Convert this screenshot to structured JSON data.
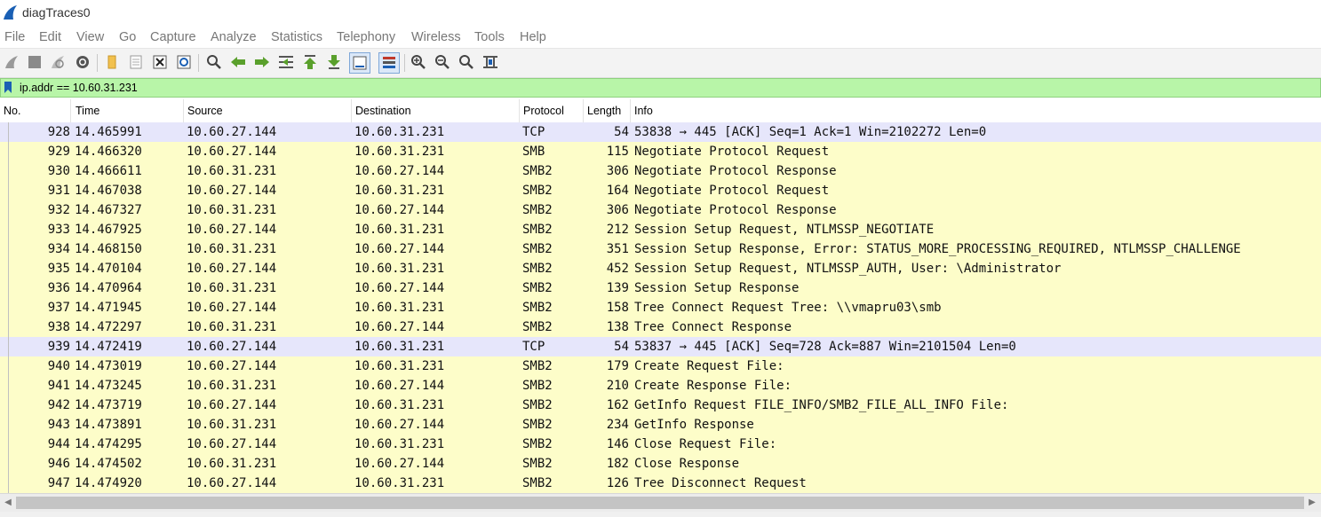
{
  "window": {
    "title": "diagTraces0"
  },
  "menu": [
    "File",
    "Edit",
    "View",
    "Go",
    "Capture",
    "Analyze",
    "Statistics",
    "Telephony",
    "Wireless",
    "Tools",
    "Help"
  ],
  "filter": {
    "value": "ip.addr == 10.60.31.231"
  },
  "columns": [
    "No.",
    "Time",
    "Source",
    "Destination",
    "Protocol",
    "Length",
    "Info"
  ],
  "packets": [
    {
      "no": "928",
      "time": "14.465991",
      "src": "10.60.27.144",
      "dst": "10.60.31.231",
      "proto": "TCP",
      "len": "54",
      "info": "53838 → 445 [ACK] Seq=1 Ack=1 Win=2102272 Len=0"
    },
    {
      "no": "929",
      "time": "14.466320",
      "src": "10.60.27.144",
      "dst": "10.60.31.231",
      "proto": "SMB",
      "len": "115",
      "info": "Negotiate Protocol Request"
    },
    {
      "no": "930",
      "time": "14.466611",
      "src": "10.60.31.231",
      "dst": "10.60.27.144",
      "proto": "SMB2",
      "len": "306",
      "info": "Negotiate Protocol Response"
    },
    {
      "no": "931",
      "time": "14.467038",
      "src": "10.60.27.144",
      "dst": "10.60.31.231",
      "proto": "SMB2",
      "len": "164",
      "info": "Negotiate Protocol Request"
    },
    {
      "no": "932",
      "time": "14.467327",
      "src": "10.60.31.231",
      "dst": "10.60.27.144",
      "proto": "SMB2",
      "len": "306",
      "info": "Negotiate Protocol Response"
    },
    {
      "no": "933",
      "time": "14.467925",
      "src": "10.60.27.144",
      "dst": "10.60.31.231",
      "proto": "SMB2",
      "len": "212",
      "info": "Session Setup Request, NTLMSSP_NEGOTIATE"
    },
    {
      "no": "934",
      "time": "14.468150",
      "src": "10.60.31.231",
      "dst": "10.60.27.144",
      "proto": "SMB2",
      "len": "351",
      "info": "Session Setup Response, Error: STATUS_MORE_PROCESSING_REQUIRED, NTLMSSP_CHALLENGE"
    },
    {
      "no": "935",
      "time": "14.470104",
      "src": "10.60.27.144",
      "dst": "10.60.31.231",
      "proto": "SMB2",
      "len": "452",
      "info": "Session Setup Request, NTLMSSP_AUTH, User: \\Administrator"
    },
    {
      "no": "936",
      "time": "14.470964",
      "src": "10.60.31.231",
      "dst": "10.60.27.144",
      "proto": "SMB2",
      "len": "139",
      "info": "Session Setup Response"
    },
    {
      "no": "937",
      "time": "14.471945",
      "src": "10.60.27.144",
      "dst": "10.60.31.231",
      "proto": "SMB2",
      "len": "158",
      "info": "Tree Connect Request Tree: \\\\vmapru03\\smb"
    },
    {
      "no": "938",
      "time": "14.472297",
      "src": "10.60.31.231",
      "dst": "10.60.27.144",
      "proto": "SMB2",
      "len": "138",
      "info": "Tree Connect Response"
    },
    {
      "no": "939",
      "time": "14.472419",
      "src": "10.60.27.144",
      "dst": "10.60.31.231",
      "proto": "TCP",
      "len": "54",
      "info": "53837 → 445 [ACK] Seq=728 Ack=887 Win=2101504 Len=0"
    },
    {
      "no": "940",
      "time": "14.473019",
      "src": "10.60.27.144",
      "dst": "10.60.31.231",
      "proto": "SMB2",
      "len": "179",
      "info": "Create Request File:"
    },
    {
      "no": "941",
      "time": "14.473245",
      "src": "10.60.31.231",
      "dst": "10.60.27.144",
      "proto": "SMB2",
      "len": "210",
      "info": "Create Response File:"
    },
    {
      "no": "942",
      "time": "14.473719",
      "src": "10.60.27.144",
      "dst": "10.60.31.231",
      "proto": "SMB2",
      "len": "162",
      "info": "GetInfo Request FILE_INFO/SMB2_FILE_ALL_INFO File:"
    },
    {
      "no": "943",
      "time": "14.473891",
      "src": "10.60.31.231",
      "dst": "10.60.27.144",
      "proto": "SMB2",
      "len": "234",
      "info": "GetInfo Response"
    },
    {
      "no": "944",
      "time": "14.474295",
      "src": "10.60.27.144",
      "dst": "10.60.31.231",
      "proto": "SMB2",
      "len": "146",
      "info": "Close Request File:"
    },
    {
      "no": "946",
      "time": "14.474502",
      "src": "10.60.31.231",
      "dst": "10.60.27.144",
      "proto": "SMB2",
      "len": "182",
      "info": "Close Response"
    },
    {
      "no": "947",
      "time": "14.474920",
      "src": "10.60.27.144",
      "dst": "10.60.31.231",
      "proto": "SMB2",
      "len": "126",
      "info": "Tree Disconnect Request"
    }
  ],
  "colors": {
    "smb_row": "#fdfdc9",
    "tcp_row": "#e6e6fb",
    "filter_valid": "#b8f5a8"
  }
}
